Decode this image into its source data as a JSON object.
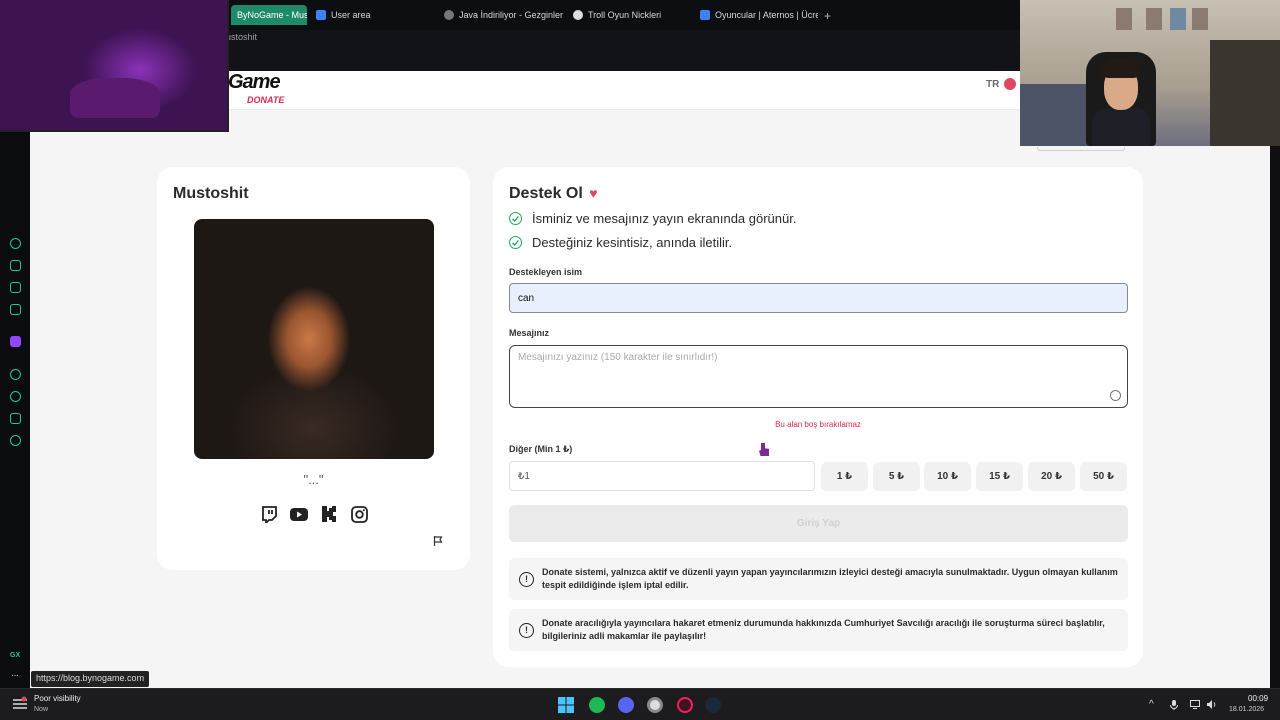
{
  "browser": {
    "tabs": [
      {
        "label": "ByNoGame - Must",
        "active": true
      },
      {
        "label": "User area",
        "active": false
      },
      {
        "label": "Java İndiriliyor - Gezginler",
        "active": false
      },
      {
        "label": "Troll Oyun Nickleri",
        "active": false
      },
      {
        "label": "Oyuncular | Aternos | Ücre",
        "active": false
      }
    ],
    "new_tab": "+",
    "address_fragment": "ustoshit",
    "status_link": "https://blog.bynogame.com"
  },
  "sidebar": {
    "gx_label": "GX",
    "more": "···",
    "icons": [
      "refresh-icon",
      "shop-icon",
      "wallet-icon",
      "m-icon",
      "twitch-icon",
      "play-icon",
      "clock-icon",
      "pin-icon",
      "settings-icon"
    ]
  },
  "header": {
    "logo_main": "Game",
    "logo_sub": "DONATE",
    "lang": "TR",
    "accent": "#d42b4f"
  },
  "profile": {
    "name": "Mustoshit",
    "bio": "\"...\"",
    "socials": [
      "twitch-icon",
      "youtube-icon",
      "kick-icon",
      "instagram-icon"
    ]
  },
  "donate": {
    "title": "Destek Ol",
    "heart": "♥",
    "feature_1": "İsminiz ve mesajınız yayın ekranında görünür.",
    "feature_2": "Desteğiniz kesintisiz, anında iletilir.",
    "name_label": "Destekleyen isim",
    "name_value": "can",
    "message_label": "Mesajınız",
    "message_placeholder": "Mesajınızı yazınız (150 karakter ile sınırlıdır!)",
    "error": "Bu alan boş bırakılamaz",
    "amount_label": "Diğer (Min 1 ₺)",
    "amount_placeholder": "₺1",
    "presets": [
      "1 ₺",
      "5 ₺",
      "10 ₺",
      "15 ₺",
      "20 ₺",
      "50 ₺"
    ],
    "submit": "Giriş Yap",
    "notice_1": "Donate sistemi, yalnızca aktif ve düzenli yayın yapan yayıncılarımızın izleyici desteği amacıyla sunulmaktadır. Uygun olmayan kullanım tespit edildiğinde işlem iptal edilir.",
    "notice_2": "Donate aracılığıyla yayıncılara hakaret etmeniz durumunda hakkınızda Cumhuriyet Savcılığı aracılığı ile soruşturma süreci başlatılır, bilgileriniz adli makamlar ile paylaşılır!"
  },
  "taskbar": {
    "weather_title": "Poor visibility",
    "weather_sub": "Now",
    "time": "00:09",
    "date": "18.01.2026",
    "apps": [
      "windows-icon",
      "spotify-icon",
      "discord-icon",
      "chrome-icon",
      "opera-gx-icon",
      "steam-icon"
    ]
  }
}
